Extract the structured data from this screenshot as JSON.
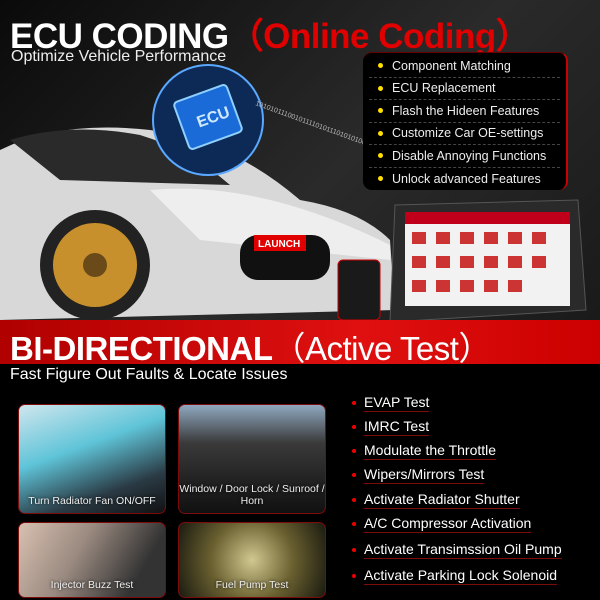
{
  "header": {
    "title_main": "ECU CODING",
    "title_paren": "（Online Coding）",
    "subtitle": "Optimize Vehicle Performance"
  },
  "features": [
    "Component Matching",
    "ECU Replacement",
    "Flash the Hideen Features",
    "Customize Car OE-settings",
    "Disable Annoying Functions",
    "Unlock advanced Features"
  ],
  "logos": {
    "chip": "ECU",
    "brand": "LAUNCH"
  },
  "binary_stream": "1010101110010111101011101010100101010",
  "colors": {
    "accent": "#e00000",
    "bullet": "#ffe000",
    "background": "#000000"
  },
  "section2": {
    "title_main": "BI-DIRECTIONAL",
    "title_paren": "（Active Test）",
    "subtitle": "Fast Figure Out Faults & Locate Issues"
  },
  "tiles": [
    {
      "caption": "Turn Radiator Fan ON/OFF"
    },
    {
      "caption": "Window / Door Lock / Sunroof / Horn"
    },
    {
      "caption": "Injector Buzz Test"
    },
    {
      "caption": "Fuel Pump Test"
    }
  ],
  "tests": [
    "EVAP Test",
    "IMRC Test",
    "Modulate the Throttle",
    "Wipers/Mirrors Test",
    "Activate Radiator Shutter",
    "A/C Compressor Activation",
    "Activate Transimssion Oil Pump",
    "Activate Parking Lock Solenoid"
  ]
}
